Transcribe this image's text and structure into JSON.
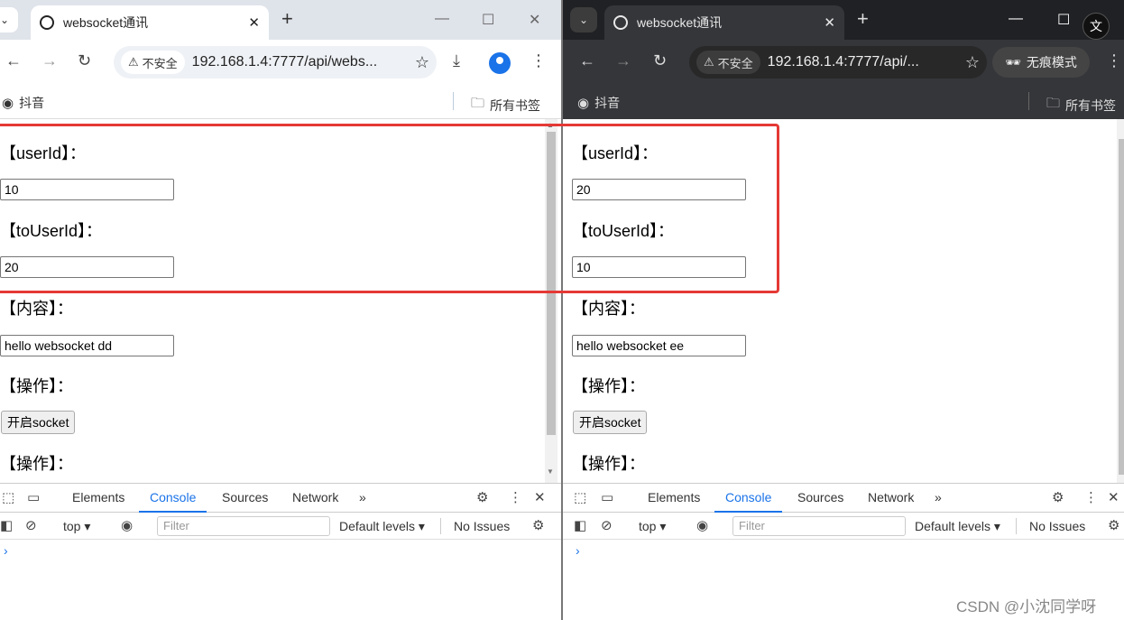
{
  "tab_search_label": "⌄",
  "windows": [
    {
      "tab_title": "websocket通讯",
      "security_chip": "不安全",
      "url": "192.168.1.4:7777/api/webs...",
      "bookmark": "抖音",
      "all_bookmarks": "所有书签",
      "page": {
        "user_id_label": "【userId】：",
        "user_id_value": "10",
        "to_user_id_label": "【toUserId】：",
        "to_user_id_value": "20",
        "content_label": "【内容】：",
        "content_value": "hello websocket dd",
        "op_label_1": "【操作】：",
        "open_socket_button": "开启socket",
        "op_label_2": "【操作】："
      },
      "devtools": {
        "tabs": [
          "Elements",
          "Console",
          "Sources",
          "Network"
        ],
        "more": "»",
        "context": "top ▾",
        "filter_placeholder": "Filter",
        "levels": "Default levels ▾",
        "issues": "No Issues",
        "prompt": "›"
      }
    },
    {
      "tab_title": "websocket通讯",
      "security_chip": "不安全",
      "url": "192.168.1.4:7777/api/...",
      "incognito_label": "无痕模式",
      "bookmark": "抖音",
      "all_bookmarks": "所有书签",
      "page": {
        "user_id_label": "【userId】：",
        "user_id_value": "20",
        "to_user_id_label": "【toUserId】：",
        "to_user_id_value": "10",
        "content_label": "【内容】：",
        "content_value": "hello websocket ee",
        "op_label_1": "【操作】：",
        "open_socket_button": "开启socket",
        "op_label_2": "【操作】："
      },
      "devtools": {
        "tabs": [
          "Elements",
          "Console",
          "Sources",
          "Network"
        ],
        "more": "»",
        "context": "top ▾",
        "filter_placeholder": "Filter",
        "levels": "Default levels ▾",
        "issues": "No Issues",
        "prompt": "›"
      }
    }
  ],
  "translate_icon_label": "文",
  "watermark": "CSDN @小沈同学呀",
  "colors": {
    "accent": "#1a73e8",
    "annotation": "#e53935",
    "incognito_bg": "#35363a"
  }
}
